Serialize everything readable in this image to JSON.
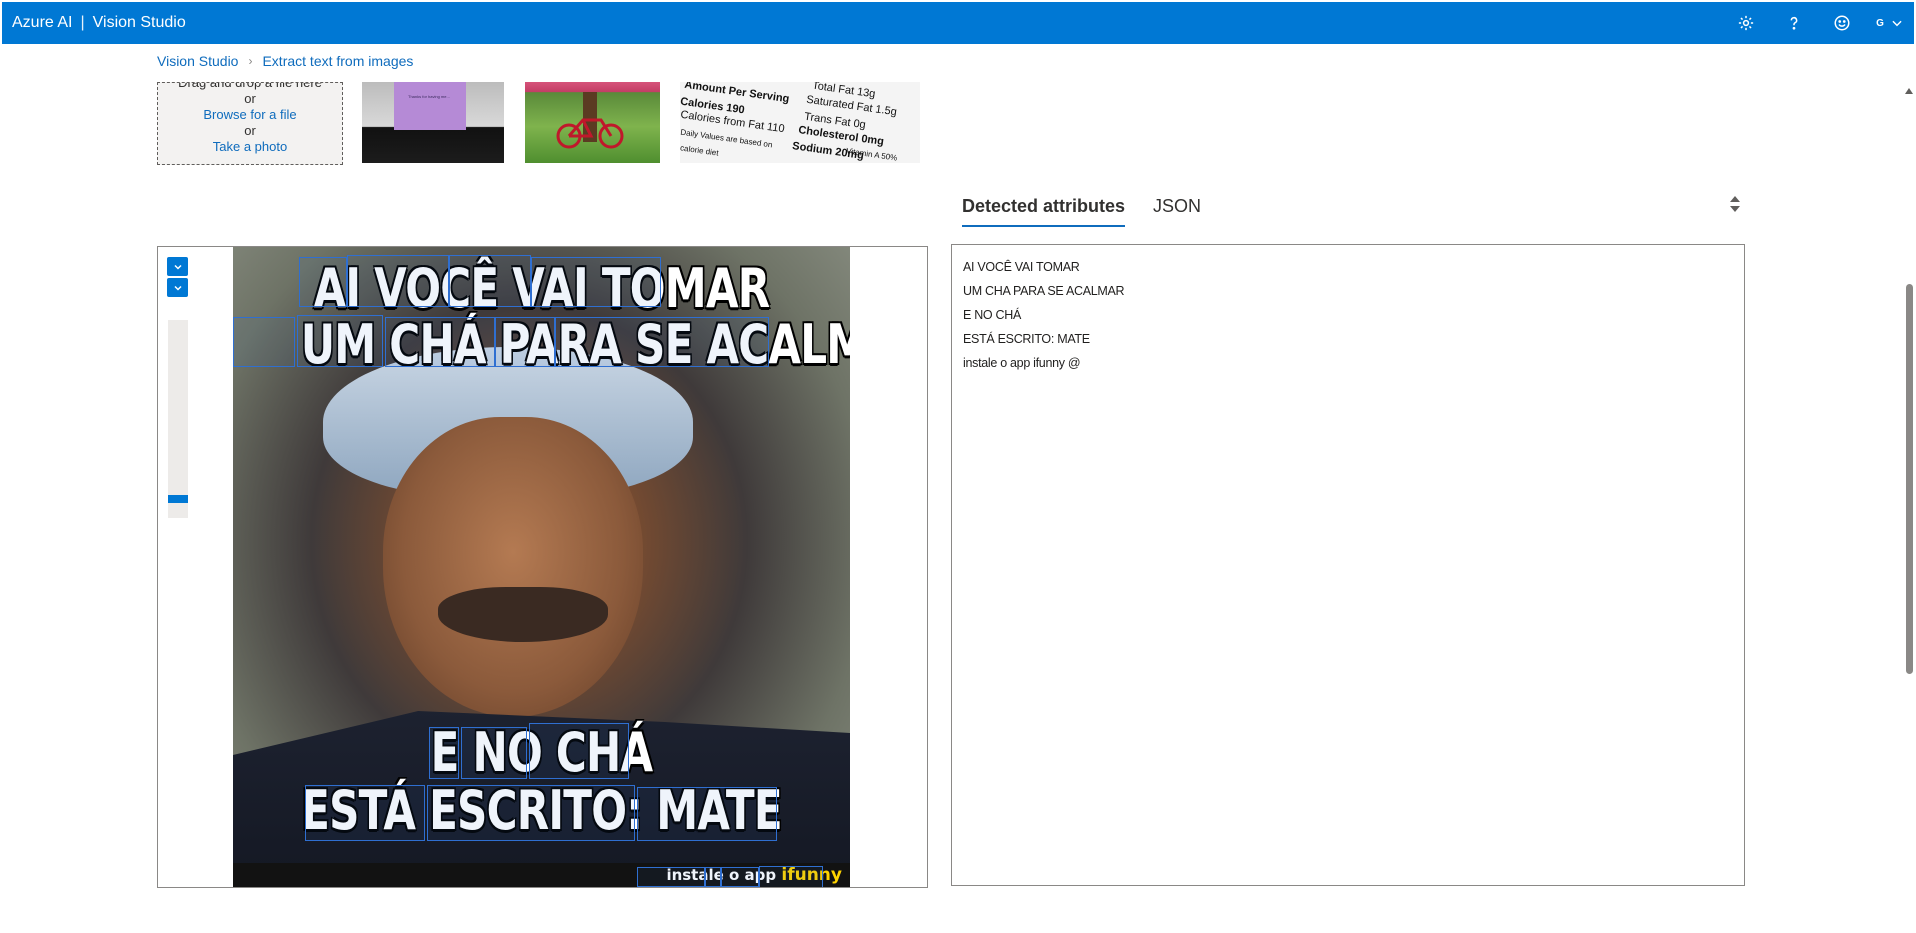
{
  "header": {
    "brand": "Azure AI",
    "separator": "|",
    "product": "Vision Studio",
    "account_initial": "G",
    "icons": [
      "gear-icon",
      "help-icon",
      "smiley-icon",
      "chevron-down-icon"
    ]
  },
  "breadcrumb": {
    "items": [
      "Vision Studio",
      "Extract text from images"
    ]
  },
  "upload": {
    "drop_text": "Drag and drop a file here",
    "or1": "or",
    "browse": "Browse for a file",
    "or2": "or",
    "photo": "Take a photo"
  },
  "samples": {
    "note_text": "Thanks for having me...",
    "label_1": "Amount Per Serving",
    "label_2": "Calories 190",
    "label_3": "Calories from Fat 110",
    "label_4": "Saturated Fat 1.5g",
    "label_5": "Trans Fat 0g",
    "label_6": "Cholesterol 0mg",
    "label_7": "Sodium 20mg",
    "label_8": "Total Fat 13g",
    "label_9": "Daily Values are based on",
    "label_10": "calorie diet",
    "label_11": "Vitamin A 50%"
  },
  "image": {
    "lines": [
      "AI VOCÊ VAI TOMAR",
      "UM CHÁ PARA SE ACALMAR",
      "E NO CHÁ",
      "ESTÁ ESCRITO: MATE"
    ],
    "watermark_text": "instale o app",
    "watermark_brand": "ifunny",
    "zoom_level": 0.08
  },
  "tabs": {
    "detected": "Detected attributes",
    "json": "JSON"
  },
  "results": {
    "lines": [
      "AI VOCÊ VAI TOMAR",
      "UM CHA PARA SE ACALMAR",
      "E NO CHÁ",
      "ESTÁ ESCRITO: MATE",
      "instale o app ifunny @"
    ]
  },
  "colors": {
    "accent": "#0078d4",
    "link": "#0f6cbd",
    "bbox": "#2f6fd1"
  }
}
